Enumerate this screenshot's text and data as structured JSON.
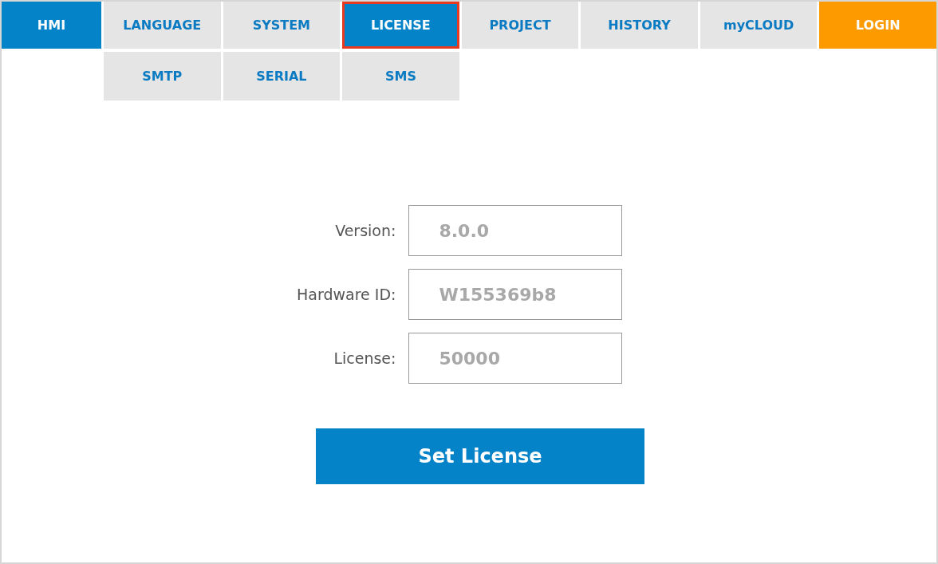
{
  "tabs": [
    {
      "label": "HMI",
      "kind": "home",
      "selected": false
    },
    {
      "label": "LANGUAGE",
      "kind": "tab",
      "selected": false
    },
    {
      "label": "SYSTEM",
      "kind": "tab",
      "selected": false
    },
    {
      "label": "LICENSE",
      "kind": "tab",
      "selected": true
    },
    {
      "label": "PROJECT",
      "kind": "tab",
      "selected": false
    },
    {
      "label": "HISTORY",
      "kind": "tab",
      "selected": false
    },
    {
      "label": "myCLOUD",
      "kind": "tab",
      "selected": false
    },
    {
      "label": "LOGIN",
      "kind": "login",
      "selected": false
    }
  ],
  "subtabs": [
    {
      "label": "SMTP",
      "selected": false
    },
    {
      "label": "SERIAL",
      "selected": false
    },
    {
      "label": "SMS",
      "selected": false
    }
  ],
  "form": {
    "fields": [
      {
        "label": "Version:",
        "value": "8.0.0"
      },
      {
        "label": "Hardware ID:",
        "value": "W155369b8"
      },
      {
        "label": "License:",
        "value": "50000"
      }
    ],
    "button": "Set License"
  }
}
